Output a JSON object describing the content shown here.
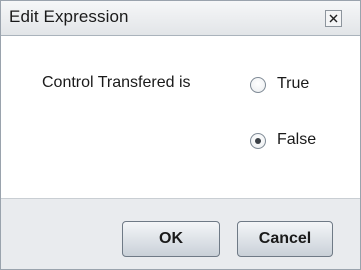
{
  "dialog": {
    "title": "Edit Expression",
    "close_icon": "close-icon"
  },
  "expression": {
    "label": "Control Transfered is",
    "options": [
      {
        "label": "True",
        "selected": false
      },
      {
        "label": "False",
        "selected": true
      }
    ]
  },
  "buttons": {
    "ok_label": "OK",
    "cancel_label": "Cancel"
  }
}
